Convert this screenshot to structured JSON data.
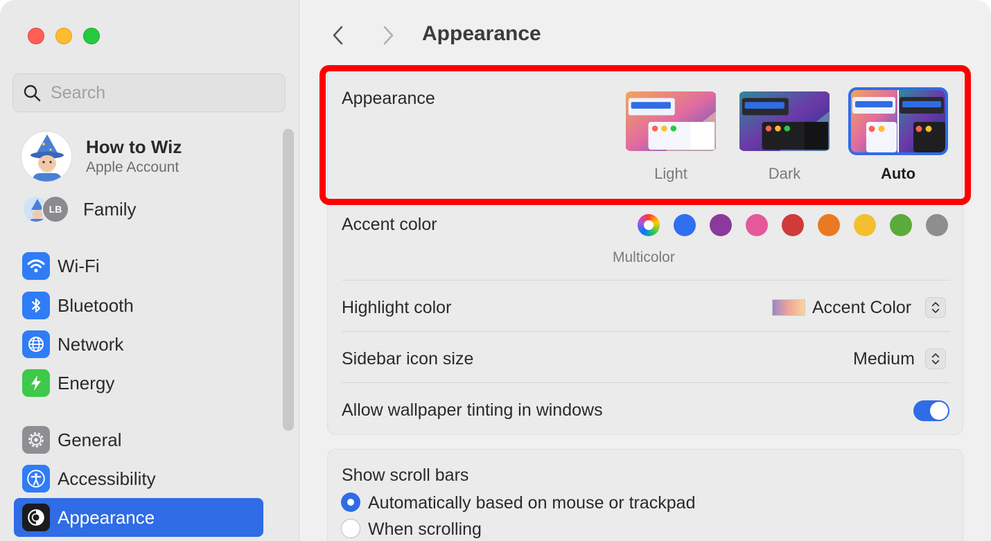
{
  "window": {
    "title": "Appearance"
  },
  "sidebar": {
    "search_placeholder": "Search",
    "account": {
      "name": "How to Wiz",
      "subtitle": "Apple Account"
    },
    "family": {
      "label": "Family",
      "initials": "LB"
    },
    "items": [
      {
        "label": "Wi-Fi",
        "icon": "wifi-icon",
        "color": "#2f7cf6"
      },
      {
        "label": "Bluetooth",
        "icon": "bluetooth-icon",
        "color": "#2f7cf6"
      },
      {
        "label": "Network",
        "icon": "globe-icon",
        "color": "#2f7cf6"
      },
      {
        "label": "Energy",
        "icon": "bolt-icon",
        "color": "#3ec94a"
      },
      {
        "label": "General",
        "icon": "gear-icon",
        "color": "#8e8e93"
      },
      {
        "label": "Accessibility",
        "icon": "accessibility-icon",
        "color": "#2f7cf6"
      },
      {
        "label": "Appearance",
        "icon": "appearance-icon",
        "color": "#1c1c1e",
        "selected": true
      }
    ]
  },
  "main": {
    "title": "Appearance",
    "appearance": {
      "label": "Appearance",
      "options": [
        {
          "label": "Light",
          "selected": false
        },
        {
          "label": "Dark",
          "selected": false
        },
        {
          "label": "Auto",
          "selected": true
        }
      ]
    },
    "accent": {
      "label": "Accent color",
      "selected_label": "Multicolor",
      "colors": [
        "multicolor",
        "#2f6ff0",
        "#8a3a9c",
        "#e5589a",
        "#cf3a3a",
        "#e97a23",
        "#f3bf2e",
        "#5aab3a",
        "#8e8e8e"
      ]
    },
    "highlight": {
      "label": "Highlight color",
      "value": "Accent Color"
    },
    "sidebar_icon_size": {
      "label": "Sidebar icon size",
      "value": "Medium"
    },
    "wallpaper_tinting": {
      "label": "Allow wallpaper tinting in windows",
      "enabled": true
    },
    "scroll_bars": {
      "label": "Show scroll bars",
      "options": [
        {
          "label": "Automatically based on mouse or trackpad",
          "selected": true
        },
        {
          "label": "When scrolling",
          "selected": false
        }
      ]
    }
  }
}
